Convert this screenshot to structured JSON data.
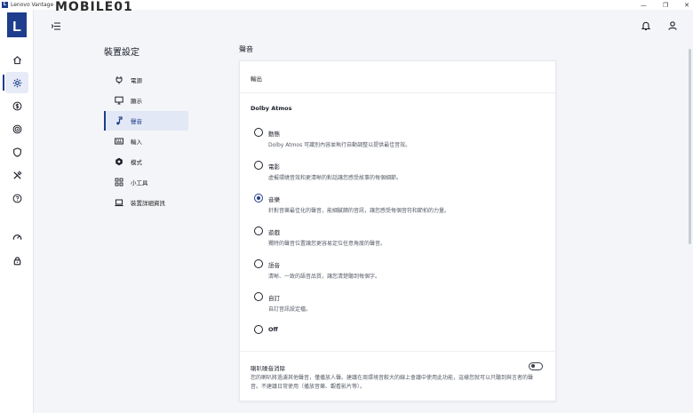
{
  "window": {
    "app_icon": "L",
    "title": "Lenovo Vantage",
    "watermark": "MOBILE01",
    "controls": [
      "—",
      "❐",
      "✕"
    ]
  },
  "rail": {
    "logo": "L",
    "items": [
      {
        "name": "home-icon"
      },
      {
        "name": "gear-icon",
        "active": true
      },
      {
        "name": "dollar-icon"
      },
      {
        "name": "wifi-target-icon"
      },
      {
        "name": "shield-icon"
      },
      {
        "name": "tools-icon"
      },
      {
        "name": "help-icon"
      },
      {
        "name": "speedometer-icon"
      },
      {
        "name": "lock-icon"
      }
    ]
  },
  "header": {
    "menu_icon": "menu-collapse-icon",
    "bell_icon": "bell-icon",
    "user_icon": "user-icon"
  },
  "subnav": {
    "title": "裝置設定",
    "items": [
      {
        "label": "電源",
        "icon": "plug-icon"
      },
      {
        "label": "顯示",
        "icon": "monitor-icon"
      },
      {
        "label": "聲音",
        "icon": "music-note-icon",
        "active": true
      },
      {
        "label": "輸入",
        "icon": "keyboard-icon"
      },
      {
        "label": "模式",
        "icon": "hexagon-icon"
      },
      {
        "label": "小工具",
        "icon": "widgets-icon"
      },
      {
        "label": "裝置詳細資訊",
        "icon": "laptop-icon"
      }
    ]
  },
  "main": {
    "title": "聲音",
    "output_label": "輸出",
    "dolby_title": "Dolby Atmos",
    "options": [
      {
        "label": "動態",
        "desc": "Dolby Atmos 可識別內容並執行自動調整以提供最佳音效。",
        "selected": false
      },
      {
        "label": "電影",
        "desc": "虛擬環繞音效和更清晰的對話讓您感受故事的每個細節。",
        "selected": false
      },
      {
        "label": "音樂",
        "desc": "針對音樂最佳化的聲音，能細膩饋的音訊，讓您感受每個音符和節拍的力量。",
        "selected": true
      },
      {
        "label": "遊戲",
        "desc": "獨特的聲音位置讓您更容易定位任意角度的聲音。",
        "selected": false
      },
      {
        "label": "語音",
        "desc": "清晰、一致的語音品質，讓您清楚聽到每個字。",
        "selected": false
      },
      {
        "label": "自訂",
        "desc": "自訂音訊設定檔。",
        "selected": false
      },
      {
        "label": "Off",
        "desc": "",
        "selected": false
      }
    ],
    "noise": {
      "title": "喇叭噪音消除",
      "desc": "您的喇叭將過濾其他聲音，僅播放人聲。建議在周環境音較大的線上會議中使用此功能，這樣您就可以只聽到與言者的聲音。不建議日常使用（播放音樂、觀看影片等）。",
      "enabled": false
    }
  }
}
